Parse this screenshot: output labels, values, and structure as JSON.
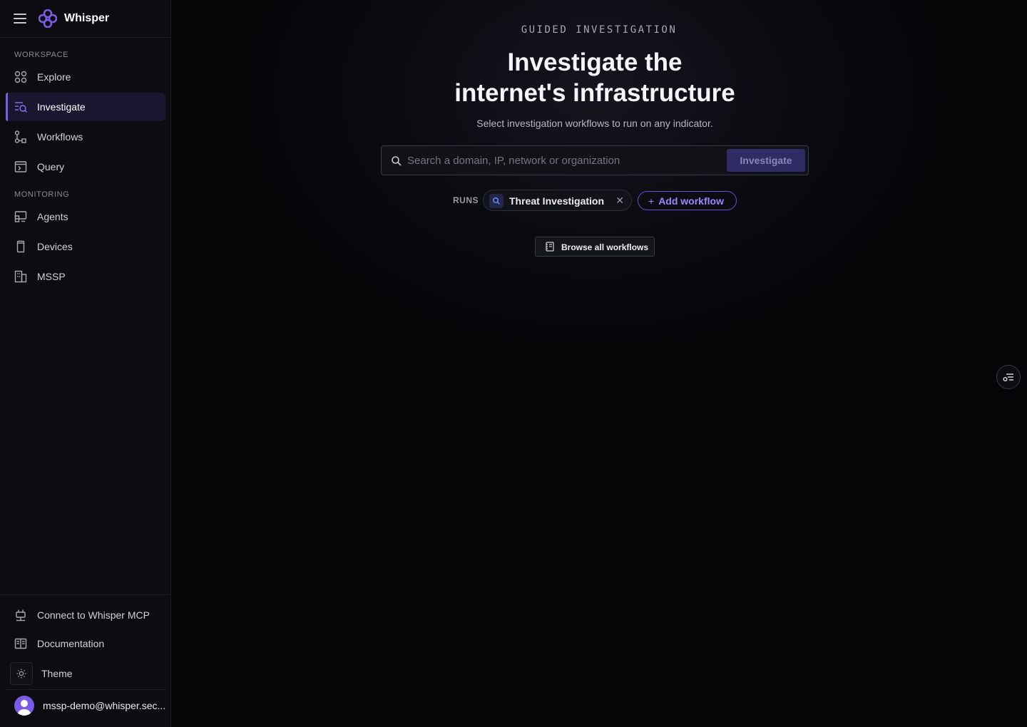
{
  "app": {
    "name": "Whisper"
  },
  "sidebar": {
    "sections": [
      {
        "label": "WORKSPACE",
        "items": [
          {
            "label": "Explore",
            "icon": "explore-icon"
          },
          {
            "label": "Investigate",
            "icon": "investigate-icon",
            "active": true
          },
          {
            "label": "Workflows",
            "icon": "workflows-icon"
          },
          {
            "label": "Query",
            "icon": "query-icon"
          }
        ]
      },
      {
        "label": "MONITORING",
        "items": [
          {
            "label": "Agents",
            "icon": "agents-icon"
          },
          {
            "label": "Devices",
            "icon": "devices-icon"
          },
          {
            "label": "MSSP",
            "icon": "mssp-icon"
          }
        ]
      }
    ],
    "footer": {
      "mcp": "Connect to Whisper MCP",
      "docs": "Documentation",
      "theme": "Theme",
      "user_email": "mssp-demo@whisper.sec..."
    }
  },
  "main": {
    "eyebrow": "GUIDED INVESTIGATION",
    "title_line1": "Investigate the",
    "title_line2": "internet's infrastructure",
    "subtitle": "Select investigation workflows to run on any indicator.",
    "search": {
      "placeholder": "Search a domain, IP, network or organization",
      "value": "",
      "button_label": "Investigate"
    },
    "runs": {
      "label": "RUNS",
      "workflows": [
        {
          "label": "Threat Investigation"
        }
      ],
      "add_label": "Add workflow"
    },
    "browse_label": "Browse all workflows"
  },
  "colors": {
    "accent": "#7c5ce4",
    "accent_text": "#9d86ff",
    "background": "#050508",
    "sidebar": "#0c0c11"
  }
}
